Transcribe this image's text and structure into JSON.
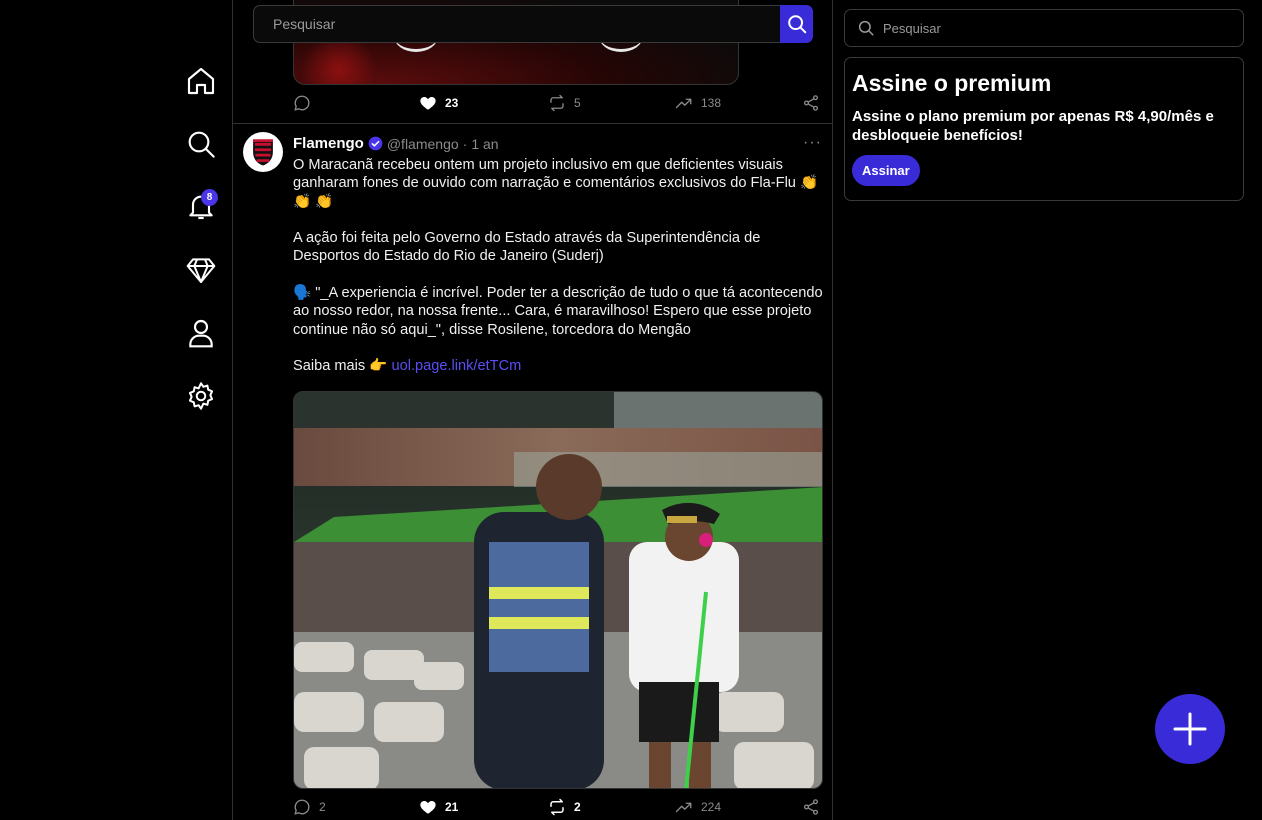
{
  "nav": {
    "items": [
      {
        "name": "home",
        "icon": "home-icon"
      },
      {
        "name": "search",
        "icon": "search-icon"
      },
      {
        "name": "notifications",
        "icon": "bell-icon",
        "badge": "8"
      },
      {
        "name": "premium",
        "icon": "diamond-icon"
      },
      {
        "name": "profile",
        "icon": "user-icon"
      },
      {
        "name": "settings",
        "icon": "gear-icon"
      }
    ]
  },
  "feed": {
    "search": {
      "placeholder": "Pesquisar",
      "button_icon": "search-icon"
    },
    "previous_post": {
      "replies": "",
      "likes": "23",
      "reposts": "5",
      "views": "138"
    },
    "post": {
      "author_name": "Flamengo",
      "handle": "@flamengo",
      "separator": "·",
      "time": "1 an",
      "more": "···",
      "paragraph1": "O Maracanã recebeu ontem um projeto inclusivo em que deficientes visuais ganharam fones de ouvido com narração e comentários exclusivos do Fla-Flu 👏 👏 👏",
      "paragraph2": "A ação foi feita pelo Governo do Estado através da Superintendência de Desportos do Estado do Rio de Janeiro (Suderj)",
      "paragraph3": "🗣️ \"_A experiencia é incrível. Poder ter a descrição de tudo o que tá acontecendo ao nosso redor, na nossa frente... Cara, é maravilhoso! Espero que esse projeto continue não só aqui_\", disse Rosilene, torcedora do Mengão",
      "saiba_mais": "Saiba mais 👉",
      "link": "uol.page.link/etTCm",
      "replies": "2",
      "likes": "21",
      "reposts": "2",
      "views": "224"
    }
  },
  "right": {
    "search": {
      "placeholder": "Pesquisar"
    },
    "premium": {
      "title": "Assine o premium",
      "text": "Assine o plano premium por apenas R$ 4,90/mês e desbloqueie benefícios!",
      "button": "Assinar"
    }
  },
  "colors": {
    "accent": "#3a2bd9",
    "link": "#5b4ef5",
    "background": "#000000",
    "border": "#2f3336"
  }
}
